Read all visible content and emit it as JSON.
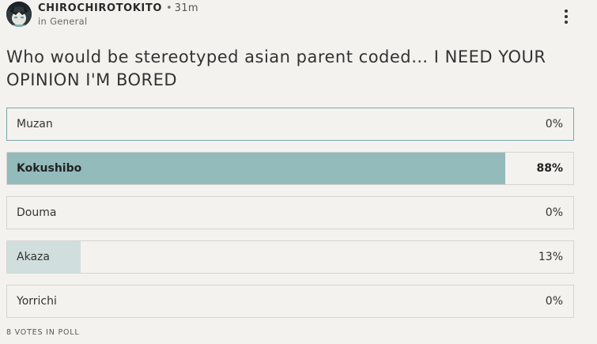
{
  "post": {
    "author": "CHIROCHIROTOKITO",
    "separator": "•",
    "time": "31m",
    "category_prefix": "in",
    "category": "General",
    "title": "Who would be stereotyped asian parent coded… I NEED YOUR OPINION I'M BORED"
  },
  "icons": {
    "avatar": "user-avatar",
    "more": "more-vertical-icon"
  },
  "poll": {
    "options": [
      {
        "label": "Muzan",
        "percent_text": "0%",
        "percent": 0
      },
      {
        "label": "Kokushibo",
        "percent_text": "88%",
        "percent": 88
      },
      {
        "label": "Douma",
        "percent_text": "0%",
        "percent": 0
      },
      {
        "label": "Akaza",
        "percent_text": "13%",
        "percent": 13
      },
      {
        "label": "Yorrichi",
        "percent_text": "0%",
        "percent": 0
      }
    ],
    "votes_text": "8 VOTES IN POLL"
  },
  "colors": {
    "winner_fill": "#94bbbb",
    "secondary_fill": "#d0dfdd",
    "selected_border": "#78a9ab",
    "background": "#f4f2ef"
  }
}
